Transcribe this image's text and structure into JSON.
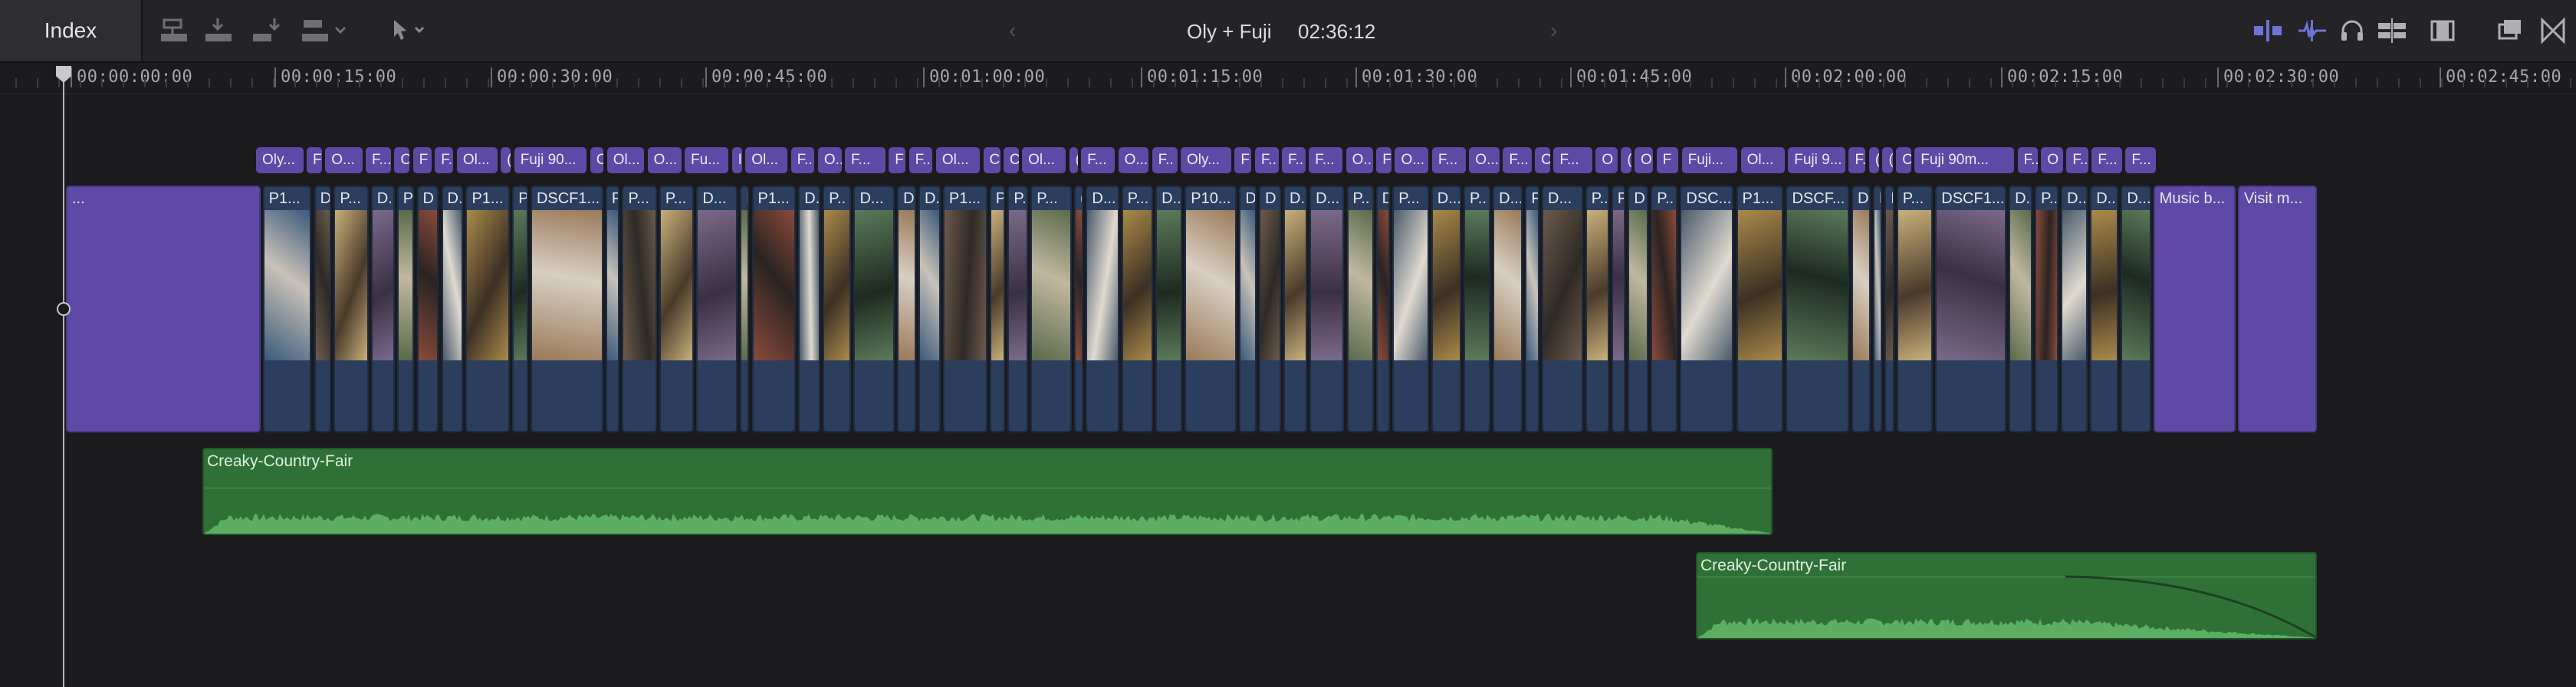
{
  "toolbar": {
    "index_label": "Index",
    "project_name": "Oly + Fuji",
    "project_duration": "02:36:12",
    "tools_left": [
      "connect-clip-icon",
      "insert-clip-icon",
      "append-clip-icon",
      "overwrite-clip-icon",
      "select-tool-icon"
    ],
    "tools_right": [
      "video-only-icon",
      "audio-only-icon",
      "headphones-icon",
      "skimming-icon",
      "clip-appearance-icon",
      "timeline-index-icon",
      "effects-browser-icon"
    ]
  },
  "ruler": {
    "timecodes": [
      "00:00:00:00",
      "00:00:15:00",
      "00:00:30:00",
      "00:00:45:00",
      "00:01:00:00",
      "00:01:15:00",
      "00:01:30:00",
      "00:01:45:00",
      "00:02:00:00",
      "00:02:15:00",
      "00:02:30:00",
      "00:02:45:00"
    ]
  },
  "connected_clips": [
    "Oly...",
    "F",
    "O...",
    "F...",
    "O",
    "F",
    "F..",
    "Ol...",
    "(",
    "Fuji 90...",
    "C",
    "Ol...",
    "O...",
    "Fu...",
    "I",
    "Ol...",
    "F..",
    "O..",
    "F...",
    "F",
    "F..",
    "Ol...",
    "C",
    "C",
    "Ol...",
    "(",
    "F...",
    "O...",
    "F..",
    "Oly...",
    "F",
    "F..",
    "F..",
    "F...",
    "O..",
    "F",
    "O...",
    "F...",
    "O...",
    "F...",
    "C",
    "F...",
    "O",
    "(",
    "O",
    "F",
    "Fuji...",
    "Ol...",
    "Fuji 9...",
    "F.",
    "(",
    "(",
    "C",
    "Fuji 90m...",
    "F..",
    "O",
    "F..",
    "F...",
    "F..."
  ],
  "primary_clips": [
    "...",
    "P1...",
    "D",
    "P...",
    "D..",
    "P",
    "D",
    "D.",
    "P1...",
    "P",
    "DSCF1...",
    "P",
    "P...",
    "P...",
    "D...",
    "I",
    "P1...",
    "D..",
    "P..",
    "D...",
    "D",
    "D..",
    "P1...",
    "P",
    "P..",
    "P...",
    "(",
    "D...",
    "P...",
    "D..",
    "P10...",
    "D",
    "D",
    "D..",
    "D...",
    "P..",
    "D",
    "P...",
    "D...",
    "P..",
    "D...",
    "F",
    "D...",
    "P..",
    "F",
    "D",
    "P..",
    "DSC...",
    "P1...",
    "DSCF...",
    "D",
    "F",
    "I",
    "P...",
    "DSCF1...",
    "D..",
    "P..",
    "D..",
    "D...",
    "D...",
    "Music b...",
    "Visit m..."
  ],
  "audio_clips": [
    {
      "label": "Creaky-Country-Fair"
    },
    {
      "label": "Creaky-Country-Fair"
    }
  ],
  "colors": {
    "connected": "#5e4aa6",
    "primary": "#2c3e5d",
    "generator": "#5e4aa6",
    "audio": "#2f7036",
    "accent_blue": "#6c74d6"
  }
}
